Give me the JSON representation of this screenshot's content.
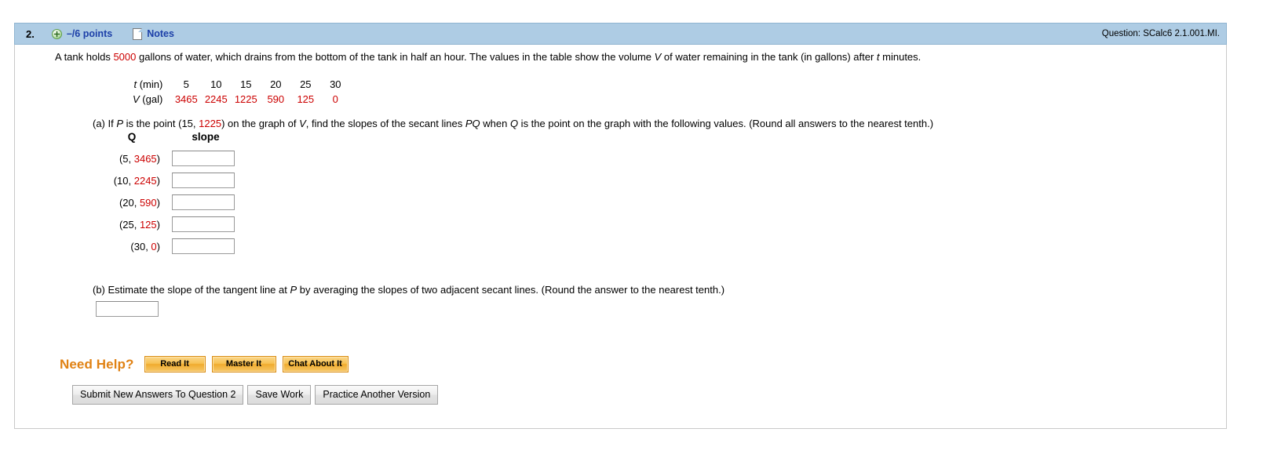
{
  "header": {
    "question_number": "2.",
    "expand_icon": "plus-circle-icon",
    "points": "–/6 points",
    "notes_icon": "notes-page-icon",
    "notes_label": "Notes",
    "question_id": "Question: SCalc6 2.1.001.MI.",
    "bar_color": "#aecce4",
    "link_color": "#1c3fa8"
  },
  "problem": {
    "text_1": "A tank holds ",
    "capacity": "5000",
    "text_2": " gallons of water, which drains from the bottom of the tank in half an hour. The values in the table show the volume ",
    "var_v": "V",
    "text_3": " of water remaining in the tank (in gallons) after ",
    "var_t": "t",
    "text_4": " minutes.",
    "value_color": "#cc0000"
  },
  "data_table": {
    "t_label_var": "t",
    "t_label_unit": " (min)",
    "v_label_var": "V",
    "v_label_unit": " (gal)",
    "t_values": [
      "5",
      "10",
      "15",
      "20",
      "25",
      "30"
    ],
    "v_values": [
      "3465",
      "2245",
      "1225",
      "590",
      "125",
      "0"
    ]
  },
  "part_a": {
    "prefix": "(a) If ",
    "var_p": "P",
    "text_1": " is the point (15, ",
    "p_value": "1225",
    "text_2": ") on the graph of ",
    "var_v": "V",
    "text_3": ", find the slopes of the secant lines ",
    "var_pq": "PQ",
    "text_4": " when ",
    "var_q": "Q",
    "text_5": " is the point on the graph with the following values. (Round all answers to the nearest tenth.)",
    "col_header_q": "Q",
    "col_header_slope": "slope",
    "rows": [
      {
        "q_prefix": "(5, ",
        "q_value": "3465",
        "q_suffix": ")",
        "slope_value": "",
        "slope_placeholder": ""
      },
      {
        "q_prefix": "(10, ",
        "q_value": "2245",
        "q_suffix": ")",
        "slope_value": "",
        "slope_placeholder": ""
      },
      {
        "q_prefix": "(20, ",
        "q_value": "590",
        "q_suffix": ")",
        "slope_value": "",
        "slope_placeholder": ""
      },
      {
        "q_prefix": "(25, ",
        "q_value": "125",
        "q_suffix": ")",
        "slope_value": "",
        "slope_placeholder": ""
      },
      {
        "q_prefix": "(30, ",
        "q_value": "0",
        "q_suffix": ")",
        "slope_value": "",
        "slope_placeholder": ""
      }
    ]
  },
  "part_b": {
    "prefix": "(b) Estimate the slope of the tangent line at ",
    "var_p": "P",
    "text": " by averaging the slopes of two adjacent secant lines. (Round the answer to the nearest tenth.)",
    "answer_value": "",
    "answer_placeholder": ""
  },
  "need_help": {
    "label": "Need Help?",
    "label_color": "#e08214",
    "buttons": [
      "Read It",
      "Master It",
      "Chat About It"
    ]
  },
  "actions": {
    "buttons": [
      "Submit New Answers To Question 2",
      "Save Work",
      "Practice Another Version"
    ]
  }
}
